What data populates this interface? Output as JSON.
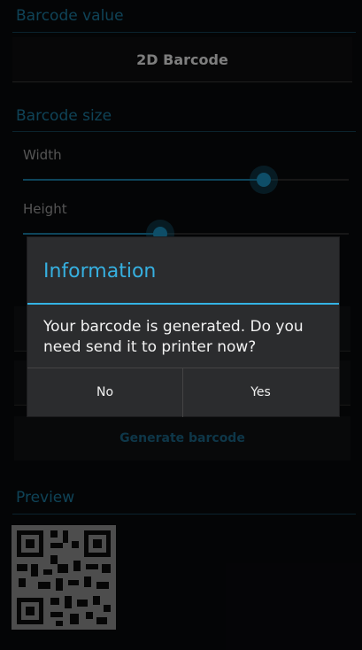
{
  "sections": {
    "barcode_value": "Barcode value",
    "barcode_size": "Barcode size",
    "preview": "Preview"
  },
  "barcode_value": {
    "text": "2D Barcode"
  },
  "sliders": {
    "width": {
      "label": "Width",
      "level": 0.74
    },
    "height": {
      "label": "Height",
      "level": 0.42
    }
  },
  "generate_button": "Generate barcode",
  "dialog": {
    "title": "Information",
    "message": "Your barcode is generated. Do you need send it to printer now?",
    "no_label": "No",
    "yes_label": "Yes"
  },
  "colors": {
    "accent": "#34b3e4",
    "background": "#090a0c",
    "dialog": "#2b2c2e"
  },
  "icons": {
    "preview_image": "qr-code-icon"
  }
}
